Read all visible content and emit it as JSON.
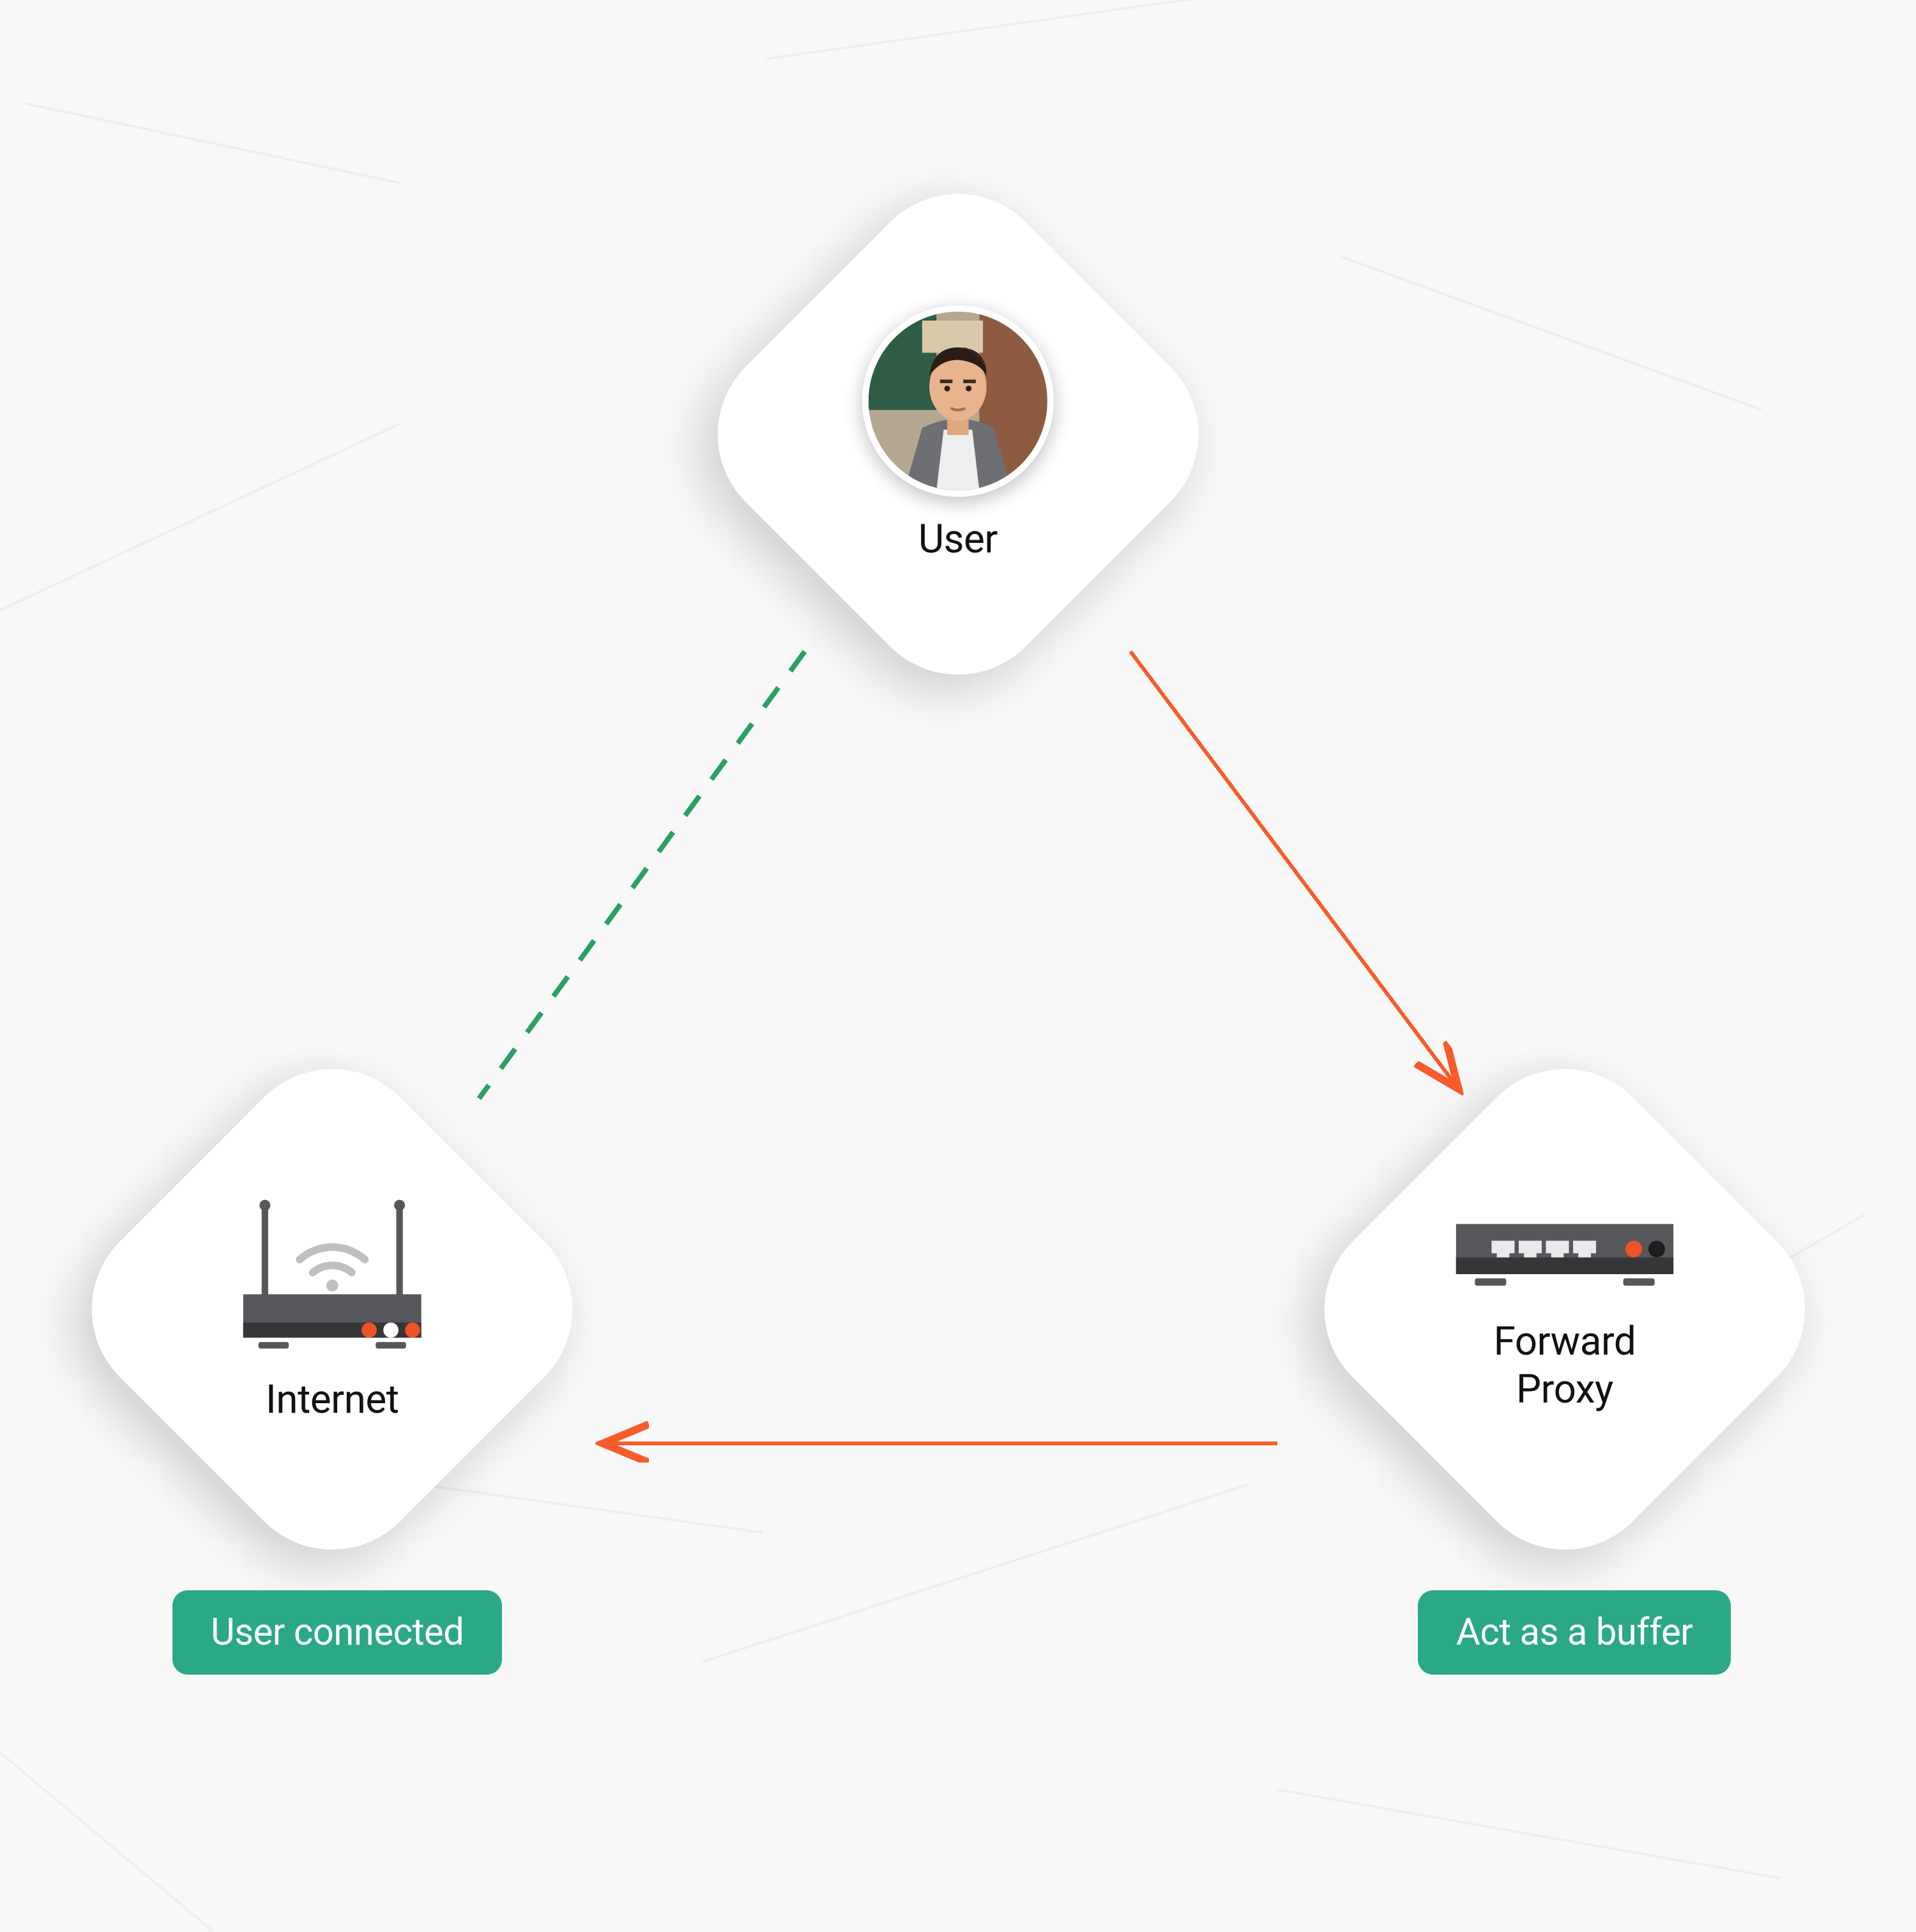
{
  "nodes": {
    "user": {
      "label": "User"
    },
    "internet": {
      "label": "Internet"
    },
    "proxy": {
      "label": "Forward\nProxy"
    }
  },
  "badges": {
    "internet": "User connected",
    "proxy": "Act as a buffer"
  },
  "colors": {
    "arrow_orange": "#f95c2b",
    "arrow_green": "#2aa063",
    "badge_bg": "#2aa887",
    "device_gray": "#55575a",
    "device_dark": "#343638",
    "device_orange": "#ee5324"
  }
}
